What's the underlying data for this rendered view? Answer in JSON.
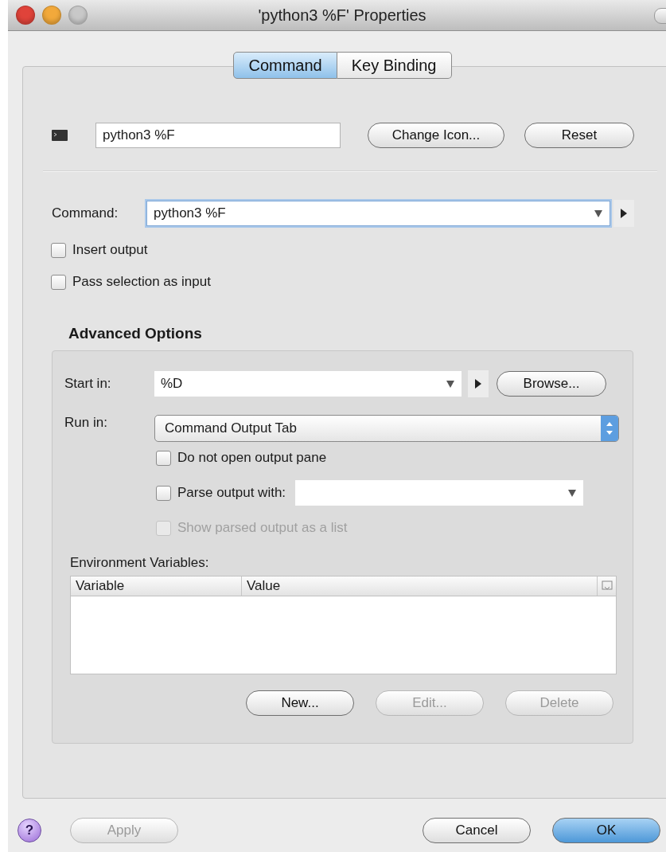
{
  "window": {
    "title": "'python3 %F' Properties"
  },
  "tabs": [
    {
      "label": "Command",
      "selected": true
    },
    {
      "label": "Key Binding",
      "selected": false
    }
  ],
  "name_row": {
    "value": "python3 %F",
    "buttons": [
      {
        "label": "Change Icon...",
        "disabled": false
      },
      {
        "label": "Reset",
        "disabled": false
      }
    ]
  },
  "command": {
    "label": "Command:",
    "value": "python3 %F",
    "focused": true
  },
  "options": [
    {
      "label": "Insert output",
      "checked": false,
      "disabled": false
    },
    {
      "label": "Pass selection as input",
      "checked": false,
      "disabled": false
    }
  ],
  "advanced": {
    "title": "Advanced Options",
    "start_in": {
      "label": "Start in:",
      "value": "%D",
      "button": "Browse..."
    },
    "run_in": {
      "label": "Run in:",
      "value": "Command Output Tab"
    },
    "checks": [
      {
        "kind": "plain",
        "label": "Do not open output pane",
        "checked": false,
        "disabled": false
      },
      {
        "kind": "combo",
        "label": "Parse output with:",
        "checked": false,
        "disabled": false
      },
      {
        "kind": "plain",
        "label": "Show parsed output as a list",
        "checked": false,
        "disabled": true
      }
    ],
    "env_label": "Environment Variables:",
    "columns": [
      "Variable",
      "Value"
    ],
    "buttons": [
      {
        "label": "New...",
        "disabled": false
      },
      {
        "label": "Edit...",
        "disabled": true
      },
      {
        "label": "Delete",
        "disabled": true
      }
    ]
  },
  "footer": {
    "help": "?",
    "buttons": [
      {
        "label": "Apply",
        "disabled": true,
        "default": false
      },
      {
        "label": "Cancel",
        "disabled": false,
        "default": false
      },
      {
        "label": "OK",
        "disabled": false,
        "default": true
      }
    ]
  }
}
